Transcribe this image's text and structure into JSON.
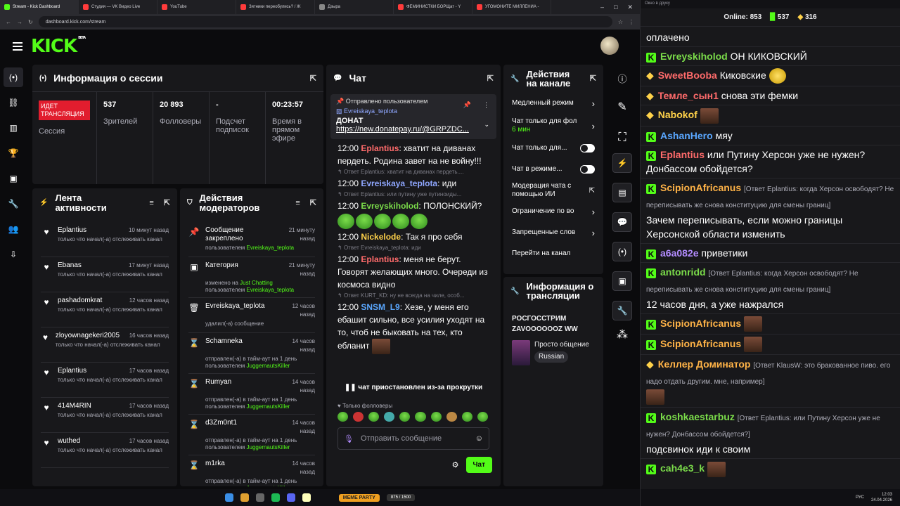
{
  "browser": {
    "tabs": [
      "Stream - Kick Dashboard",
      "Студия — VK Видео Live",
      "YouTube",
      "Зятники переобулись? / Ж",
      "Дзыра",
      "ФЕМИНИСТКИ БОРЩат - Y",
      "УГОМОНИТЕ МИЛЛЕНИА -"
    ],
    "url": "dashboard.kick.com/stream"
  },
  "kick": {
    "logo": "KICK",
    "beta": "BETA"
  },
  "session": {
    "title": "Информация о сессии",
    "live_badge": "ИДЕТ ТРАНСЛЯЦИЯ",
    "live_label": "Сессия",
    "stats": [
      {
        "value": "537",
        "label": "Зрителей"
      },
      {
        "value": "20 893",
        "label": "Фолловеры"
      },
      {
        "value": "-",
        "label": "Подсчет подписок"
      },
      {
        "value": "00:23:57",
        "label": "Время в прямом эфире"
      }
    ]
  },
  "activity": {
    "title": "Лента активности",
    "items": [
      {
        "name": "Eplantius",
        "time": "10 минут назад",
        "text": "только что начал(-а) отслеживать канал"
      },
      {
        "name": "Ebanas",
        "time": "17 минут назад",
        "text": "только что начал(-а) отслеживать канал"
      },
      {
        "name": "pashadomkrat",
        "time": "12 часов назад",
        "text": "только что начал(-а) отслеживать канал"
      },
      {
        "name": "zloyownagekeri2005",
        "time": "16 часов назад",
        "text": "только что начал(-а) отслеживать канал"
      },
      {
        "name": "Eplantius",
        "time": "17 часов назад",
        "text": "только что начал(-а) отслеживать канал"
      },
      {
        "name": "414M4RIN",
        "time": "17 часов назад",
        "text": "только что начал(-а) отслеживать канал"
      },
      {
        "name": "wuthed",
        "time": "17 часов назад",
        "text": "только что начал(-а) отслеживать канал"
      }
    ]
  },
  "modactions": {
    "title": "Действия модераторов",
    "items": [
      {
        "icon": "pin",
        "name": "Сообщение закреплено",
        "time": "21 минуту назад",
        "line1": "пользователем",
        "green1": "Evreiskaya_teplota",
        "line2": "",
        "green2": ""
      },
      {
        "icon": "category",
        "name": "Категория",
        "time": "21 минуту назад",
        "line1": "изменено на",
        "green1": "Just Chatting",
        "line2": "пользователем",
        "green2": "Evreiskaya_teplota"
      },
      {
        "icon": "trash",
        "name": "Evreiskaya_teplota",
        "time": "12 часов назад",
        "line1": "удалил(-а) сообщение",
        "green1": "",
        "line2": "",
        "green2": ""
      },
      {
        "icon": "timeout",
        "name": "Schamneka",
        "time": "14 часов назад",
        "line1": "отправлен(-а) в тайм-аут на 1 день",
        "green1": "",
        "line2": "пользователем",
        "green2": "JuggernautsKiller"
      },
      {
        "icon": "timeout",
        "name": "Rumyan",
        "time": "14 часов назад",
        "line1": "отправлен(-а) в тайм-аут на 1 день",
        "green1": "",
        "line2": "пользователем",
        "green2": "JuggernautsKiller"
      },
      {
        "icon": "timeout",
        "name": "d3Zm0nt1",
        "time": "14 часов назад",
        "line1": "отправлен(-а) в тайм-аут на 1 день",
        "green1": "",
        "line2": "пользователем",
        "green2": "JuggernautsKiller"
      },
      {
        "icon": "timeout",
        "name": "m1rka",
        "time": "14 часов назад",
        "line1": "отправлен(-а) в тайм-аут на 1 день",
        "green1": "",
        "line2": "пользователем",
        "green2": "JuggernautsKiller"
      }
    ]
  },
  "chat": {
    "title": "Чат",
    "pinned": {
      "header": "Отправлено пользователем",
      "user": "Evreiskaya_teplota",
      "label": "ДОНАТ",
      "link": "https://new.donatepay.ru/@GRPZDC..."
    },
    "messages": [
      {
        "reply": "",
        "time": "12:00",
        "user": "Eplantius",
        "color": "#ff6b6b",
        "text": ": хватит на диванах пердеть. Родина завет на не войну!!!"
      },
      {
        "reply": "Ответ Eplantius: хватит на диванах пердеть....",
        "time": "12:00",
        "user": "Evreiskaya_teplota",
        "color": "#8fa7ff",
        "text": ": иди"
      },
      {
        "reply": "Ответ Eplantius: или путину уже путиноиды...",
        "time": "12:00",
        "user": "Evreyskiholod",
        "color": "#7bdc4a",
        "text": ": ПОЛОНСКИЙ?"
      },
      {
        "reply": "",
        "time": "12:00",
        "user": "Nickelode",
        "color": "#ffd24a",
        "text": ": Так я про себя"
      },
      {
        "reply": "Ответ Evreiskaya_teplota: иди",
        "time": "12:00",
        "user": "Eplantius",
        "color": "#ff6b6b",
        "text": ": меня не берут. Говорят желающих много. Очереди из космоса видно"
      },
      {
        "reply": "Ответ KURT_KD: ну не всегда на чиле, особ...",
        "time": "12:00",
        "user": "SNSM_L9",
        "color": "#5aa7ff",
        "text": ": Хезе, у меня его ебашит сильно, все усилия уходят на то, чтоб не быковать на тех, кто ебланит"
      }
    ],
    "paused": "чат приостановлен из-за прокрутки",
    "followers_only": "Только фолловеры",
    "input_placeholder": "Отправить сообщение",
    "send": "Чат"
  },
  "channel_actions": {
    "title": "Действия на канале",
    "items": [
      {
        "label": "Медленный режим",
        "sub": "",
        "ctrl": "chevron"
      },
      {
        "label": "Чат только для фол",
        "sub": "6 мин",
        "ctrl": "chevron"
      },
      {
        "label": "Чат только для...",
        "sub": "",
        "ctrl": "toggle"
      },
      {
        "label": "Чат в режиме...",
        "sub": "",
        "ctrl": "toggle"
      },
      {
        "label": "Модерация чата с помощью ИИ",
        "sub": "",
        "ctrl": "external"
      },
      {
        "label": "Ограничение по во",
        "sub": "",
        "ctrl": "chevron"
      },
      {
        "label": "Запрещенные слов",
        "sub": "",
        "ctrl": "chevron"
      },
      {
        "label": "Перейти на канал",
        "sub": "",
        "ctrl": "none"
      }
    ]
  },
  "stream_info": {
    "title": "Информация о трансляции",
    "stream_title": "РОСГОССТРИМ ZAVOOOOOOZ WW",
    "category": "Просто общение",
    "language": "Russian"
  },
  "popout": {
    "title": "Окно в друку",
    "online_label": "Online:",
    "online": "853",
    "kick_count": "537",
    "other_count": "316",
    "messages": [
      {
        "name": "",
        "color": "#ffffff",
        "text": "оплачено",
        "reply": "",
        "badge": "none"
      },
      {
        "name": "Evreyskiholod",
        "color": "#7bdc4a",
        "text": "ОН КИКОВСКИЙ",
        "reply": "",
        "badge": "kick"
      },
      {
        "name": "SweetBooba",
        "color": "#ff6b6b",
        "text": "Киковские",
        "reply": "",
        "badge": "other"
      },
      {
        "name": "Темле_сын1",
        "color": "#ff6b6b",
        "text": "снова эти фемки",
        "reply": "",
        "badge": "other"
      },
      {
        "name": "Nabokof",
        "color": "#ffd24a",
        "text": "",
        "reply": "",
        "badge": "other"
      },
      {
        "name": "AshanHero",
        "color": "#5aa7ff",
        "text": "мяу",
        "reply": "",
        "badge": "kick"
      },
      {
        "name": "Eplantius",
        "color": "#ff6b6b",
        "text": "или Путину Херсон уже не нужен? Донбассом обойдется?",
        "reply": "",
        "badge": "kick"
      },
      {
        "name": "ScipionAfricanus",
        "color": "#ffb347",
        "text": "Зачем переписывать, если можно границы Херсонской области изменить",
        "reply": "[Ответ Eplantius: когда Херсон освободят? Не переписывать же снова конституцию для смены границ]",
        "badge": "kick"
      },
      {
        "name": "a6a082e",
        "color": "#b38cff",
        "text": "приветики",
        "reply": "",
        "badge": "kick"
      },
      {
        "name": "antonridd",
        "color": "#7bdc4a",
        "text": "12 часов дня, а уже нажрался",
        "reply": "[Ответ Eplantius: когда Херсон освободят? Не переписывать же снова конституцию для смены границ]",
        "badge": "kick"
      },
      {
        "name": "ScipionAfricanus",
        "color": "#ffb347",
        "text": "",
        "reply": "",
        "badge": "kick"
      },
      {
        "name": "ScipionAfricanus",
        "color": "#ffb347",
        "text": "",
        "reply": "",
        "badge": "kick"
      },
      {
        "name": "Келлер Доминатор",
        "color": "#ffb347",
        "text": "",
        "reply": "[Ответ KlausW: это бракованное пиво. его надо отдать другим. мне, например]",
        "badge": "other"
      },
      {
        "name": "koshkaestarbuz",
        "color": "#7bdc4a",
        "text": "подсвинок иди к своим",
        "reply": "[Ответ Eplantius: или Путину Херсон уже не нужен? Донбассом обойдется?]",
        "badge": "kick"
      },
      {
        "name": "cah4e3_k",
        "color": "#7bdc4a",
        "text": "",
        "reply": "",
        "badge": "kick"
      }
    ]
  },
  "taskbar": {
    "widget": "MEME PARTY",
    "widget_count": "875 / 1500",
    "lang": "РУС",
    "time": "12:03",
    "date": "24.04.2026"
  }
}
